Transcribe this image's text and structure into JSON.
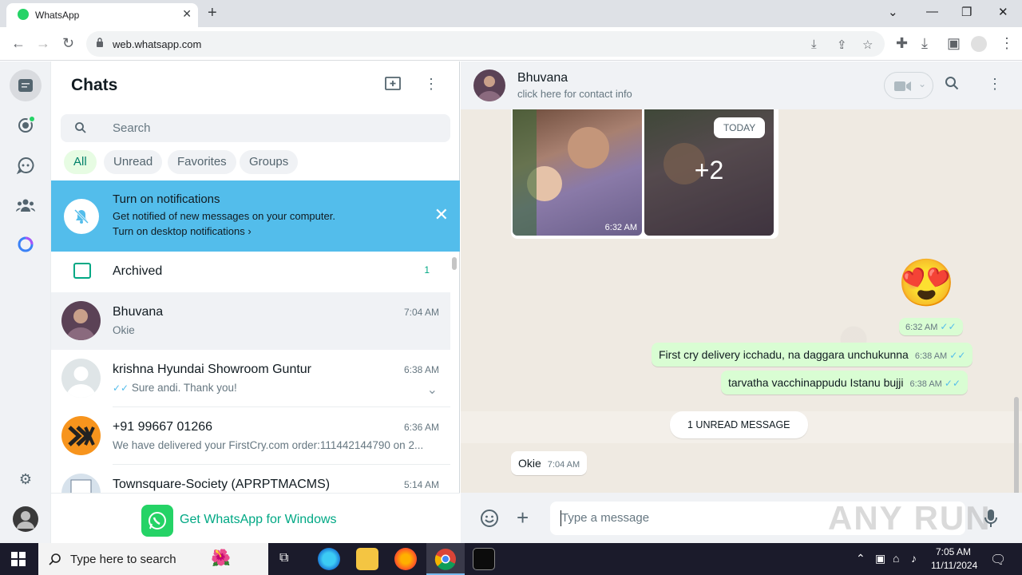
{
  "browser": {
    "tab_title": "WhatsApp",
    "url": "web.whatsapp.com"
  },
  "sidebar": {
    "title": "Chats",
    "search_placeholder": "Search",
    "filters": [
      {
        "label": "All"
      },
      {
        "label": "Unread"
      },
      {
        "label": "Favorites"
      },
      {
        "label": "Groups"
      }
    ],
    "notification": {
      "title": "Turn on notifications",
      "subtitle": "Get notified of new messages on your computer.",
      "action": "Turn on desktop notifications"
    },
    "archived": {
      "label": "Archived",
      "count": "1"
    },
    "chats": [
      {
        "name": "Bhuvana",
        "time": "7:04 AM",
        "message": "Okie"
      },
      {
        "name": "krishna Hyundai Showroom Guntur",
        "time": "6:38 AM",
        "message": "Sure andi. Thank you!"
      },
      {
        "name": "+91 99667 01266",
        "time": "6:36 AM",
        "message": "We have delivered your FirstCry.com order:111442144790 on 2..."
      },
      {
        "name": "Townsquare-Society (APRPTMACMS)",
        "time": "5:14 AM",
        "message": ""
      }
    ],
    "get_windows": "Get WhatsApp for Windows"
  },
  "conversation": {
    "contact_name": "Bhuvana",
    "contact_sub": "click here for contact info",
    "album_time": "6:32 AM",
    "album_more": "+2",
    "date_chip": "TODAY",
    "emoji": "😍",
    "emoji_time": "6:32 AM",
    "outgoing": [
      {
        "text": "First cry delivery icchadu, na daggara unchukunna",
        "time": "6:38 AM"
      },
      {
        "text": "tarvatha vacchinappudu Istanu bujji",
        "time": "6:38 AM"
      }
    ],
    "unread_label": "1 UNREAD MESSAGE",
    "incoming": {
      "text": "Okie",
      "time": "7:04 AM"
    },
    "input_placeholder": "Type a message",
    "watermark": "ANY RUN"
  },
  "taskbar": {
    "search_placeholder": "Type here to search",
    "time": "7:05 AM",
    "date": "11/11/2024"
  },
  "colors": {
    "accent": "#00a884",
    "notification_bg": "#53bdeb",
    "outgoing_bubble": "#d9fdd3",
    "read_ticks": "#53bdeb"
  }
}
